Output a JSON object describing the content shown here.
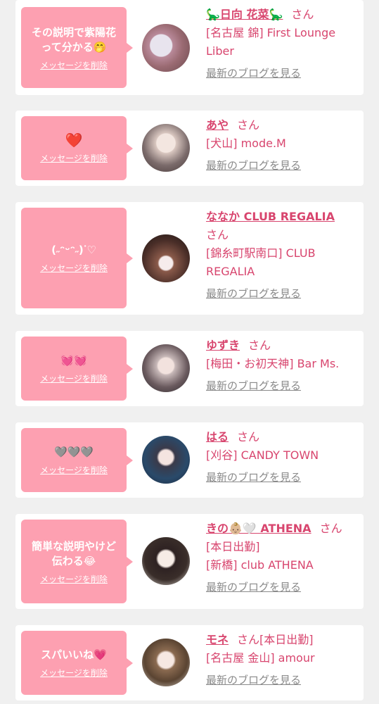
{
  "messages": [
    {
      "message": "その説明で紫陽花\nって分かる🤭",
      "delete_label": "メッセージを削除",
      "name": "🦕日向 花菜🦕",
      "honorific": "さん",
      "shop_lines": [
        "[名古屋 錦] First Lounge",
        "Liber"
      ],
      "blog_label": "最新のブログを見る"
    },
    {
      "message": "❤️",
      "delete_label": "メッセージを削除",
      "name": "あや",
      "honorific": "さん",
      "shop_lines": [
        "[犬山] mode.M"
      ],
      "blog_label": "最新のブログを見る"
    },
    {
      "message": "(˶ᵔᵕᵔ˶)ᐝ♡",
      "delete_label": "メッセージを削除",
      "name": "ななか CLUB REGALIA",
      "honorific": "さん",
      "shop_lines": [
        "[錦糸町駅南口] CLUB",
        "REGALIA"
      ],
      "blog_label": "最新のブログを見る"
    },
    {
      "message": "💓💓",
      "delete_label": "メッセージを削除",
      "name": "ゆずき",
      "honorific": "さん",
      "shop_lines": [
        "[梅田・お初天神] Bar Ms."
      ],
      "blog_label": "最新のブログを見る"
    },
    {
      "message": "🩶🩶🩶",
      "delete_label": "メッセージを削除",
      "name": "はる",
      "honorific": "さん",
      "shop_lines": [
        "[刈谷] CANDY TOWN"
      ],
      "blog_label": "最新のブログを見る"
    },
    {
      "message": "簡単な説明やけど\n伝わる😂",
      "delete_label": "メッセージを削除",
      "name": "きの👶🏼🤍 ATHENA",
      "honorific": "さん",
      "shop_lines": [
        "[本日出勤]",
        "[新橋] club ATHENA"
      ],
      "blog_label": "最新のブログを見る"
    },
    {
      "message": "スパいいね💗",
      "delete_label": "メッセージを削除",
      "name": "モネ",
      "honorific": "さん[本日出勤]",
      "shop_lines": [
        "[名古屋 金山] amour"
      ],
      "blog_label": "最新のブログを見る"
    }
  ],
  "colors": {
    "accent": "#d8456e",
    "bubble": "#fda0b1",
    "background": "#f0f0f0",
    "muted": "#8a8a8a"
  }
}
